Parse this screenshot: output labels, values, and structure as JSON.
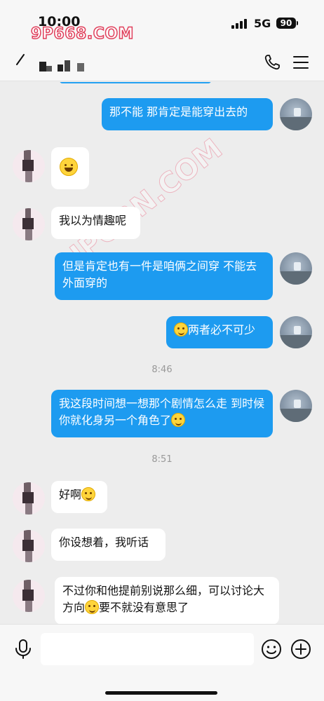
{
  "status_bar": {
    "time": "10:00",
    "network": "5G",
    "battery": "90",
    "watermark": "9P668.COM"
  },
  "nav": {
    "contact_name": "■ ■■　■",
    "icons": [
      "back-icon",
      "call-icon",
      "menu-icon"
    ]
  },
  "watermark_diagonal": "9IPORN.COM",
  "messages": [
    {
      "side": "me",
      "text": "那不能  那肯定是能穿出去的"
    },
    {
      "side": "them",
      "text": "",
      "emoji": "laughing-emoji"
    },
    {
      "side": "them",
      "text": "我以为情趣呢"
    },
    {
      "side": "me",
      "text": "但是肯定也有一件是咱俩之间穿 不能去外面穿的"
    },
    {
      "side": "me",
      "text": "两者必不可少",
      "emoji_before": "thinking-emoji"
    },
    {
      "type": "time",
      "text": "8:46"
    },
    {
      "side": "me",
      "text": "我这段时间想一想那个剧情怎么走  到时候你就化身另一个角色了",
      "emoji_after": "smile-emoji"
    },
    {
      "type": "time",
      "text": "8:51"
    },
    {
      "side": "them",
      "text": "好啊",
      "emoji_after": "thinking-emoji"
    },
    {
      "side": "them",
      "text": "你设想着，我听话"
    },
    {
      "side": "them",
      "text_part1": "不过你和他提前别说那么细，可以讨论大方向",
      "text_part2": "要不就没有意思了",
      "emoji_mid": "thinking-emoji"
    }
  ],
  "input_bar": {
    "placeholder": "",
    "icons": [
      "voice-icon",
      "emoji-button",
      "plus-button"
    ]
  },
  "colors": {
    "my_bubble": "#1d9bf0",
    "their_bubble": "#ffffff",
    "background": "#ededed"
  }
}
